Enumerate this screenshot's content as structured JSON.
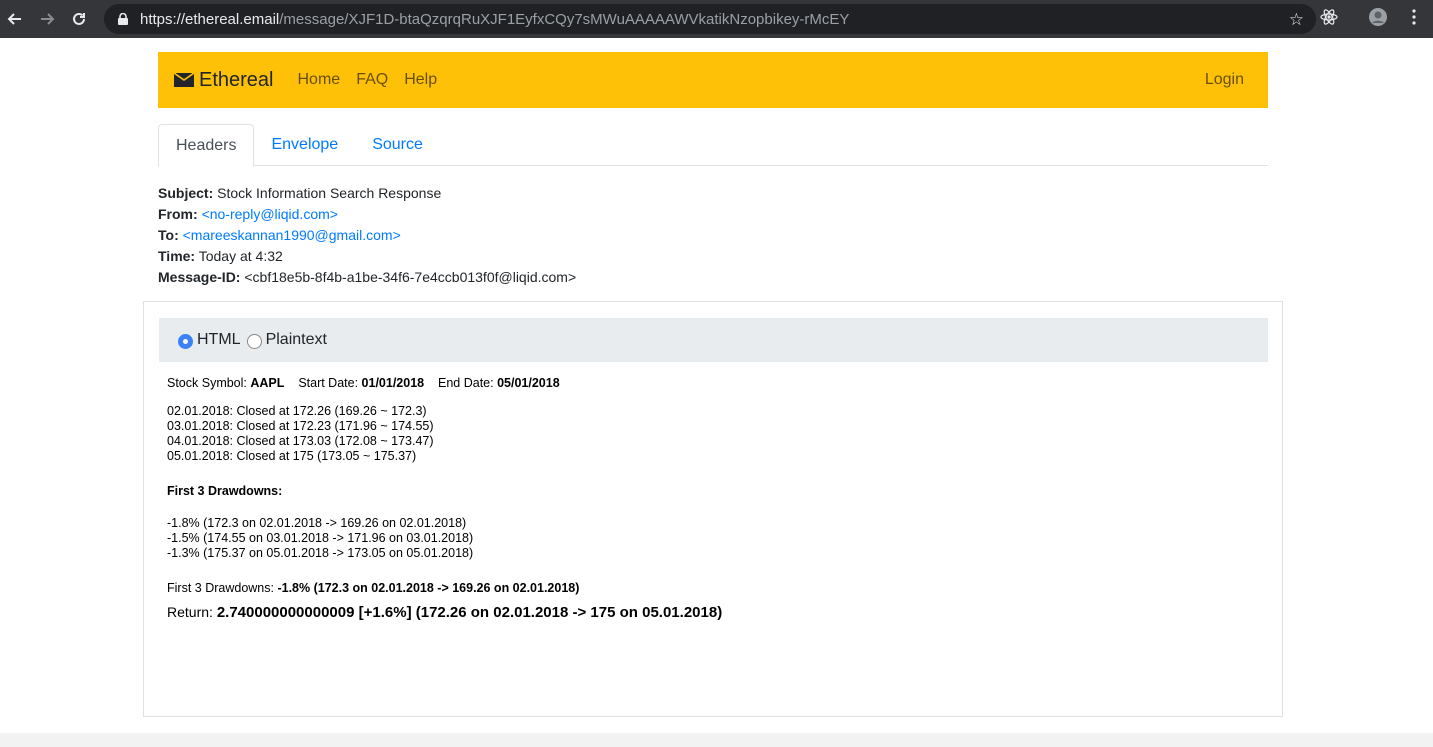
{
  "browser": {
    "url_host": "https://ethereal.email",
    "url_path": "/message/XJF1D-btaQzqrqRuXJF1EyfxCQy7sMWuAAAAAWVkatikNzopbikey-rMcEY",
    "icons": [
      "back-icon",
      "forward-icon",
      "reload-icon",
      "lock-icon",
      "star-icon",
      "react-devtools-icon",
      "profile-icon",
      "menu-icon"
    ]
  },
  "navbar": {
    "brand": "Ethereal",
    "links": [
      "Home",
      "FAQ",
      "Help"
    ],
    "login": "Login",
    "color": "#ffc107"
  },
  "tabs": [
    "Headers",
    "Envelope",
    "Source"
  ],
  "headers": {
    "subject_label": "Subject:",
    "subject": "Stock Information Search Response",
    "from_label": "From:",
    "from": "<no-reply@liqid.com>",
    "to_label": "To:",
    "to": "<mareeskannan1990@gmail.com>",
    "time_label": "Time:",
    "time": "Today at 4:32",
    "msgid_label": "Message-ID:",
    "msgid": "<cbf18e5b-8f4b-a1be-34f6-7e4ccb013f0f@liqid.com>"
  },
  "format": {
    "html": "HTML",
    "plaintext": "Plaintext",
    "selected": "HTML"
  },
  "message": {
    "symbol_label": "Stock Symbol:",
    "symbol": "AAPL",
    "start_label": "Start Date:",
    "start": "01/01/2018",
    "end_label": "End Date:",
    "end": "05/01/2018",
    "closes": [
      "02.01.2018: Closed at 172.26 (169.26 ~ 172.3)",
      "03.01.2018: Closed at 172.23 (171.96 ~ 174.55)",
      "04.01.2018: Closed at 173.03 (172.08 ~ 173.47)",
      "05.01.2018: Closed at 175 (173.05 ~ 175.37)"
    ],
    "drawdowns_heading": "First 3 Drawdowns:",
    "drawdowns": [
      "-1.8% (172.3 on 02.01.2018 -> 169.26 on 02.01.2018)",
      "-1.5% (174.55 on 03.01.2018 -> 171.96 on 03.01.2018)",
      "-1.3% (175.37 on 05.01.2018 -> 173.05 on 05.01.2018)"
    ],
    "summary_label": "First 3 Drawdowns:",
    "summary": "-1.8% (172.3 on 02.01.2018 -> 169.26 on 02.01.2018)",
    "return_label": "Return:",
    "return": "2.740000000000009 [+1.6%] (172.26 on 02.01.2018 -> 175 on 05.01.2018)"
  }
}
